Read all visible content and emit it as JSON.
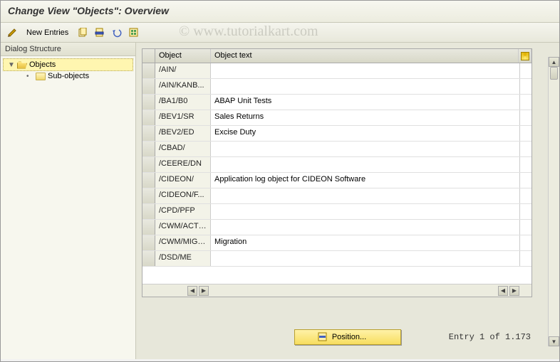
{
  "title": "Change View \"Objects\": Overview",
  "watermark": "© www.tutorialkart.com",
  "toolbar": {
    "new_entries": "New Entries"
  },
  "tree": {
    "header": "Dialog Structure",
    "root": {
      "label": "Objects"
    },
    "child": {
      "label": "Sub-objects"
    }
  },
  "table": {
    "columns": {
      "object": "Object",
      "object_text": "Object text"
    },
    "rows": [
      {
        "obj": "/AIN/",
        "txt": ""
      },
      {
        "obj": "/AIN/KANB...",
        "txt": ""
      },
      {
        "obj": "/BA1/B0",
        "txt": "ABAP Unit Tests"
      },
      {
        "obj": "/BEV1/SR",
        "txt": "Sales Returns"
      },
      {
        "obj": "/BEV2/ED",
        "txt": "Excise Duty"
      },
      {
        "obj": "/CBAD/",
        "txt": ""
      },
      {
        "obj": "/CEERE/DN",
        "txt": ""
      },
      {
        "obj": "/CIDEON/",
        "txt": "Application log object for CIDEON Software"
      },
      {
        "obj": "/CIDEON/F...",
        "txt": ""
      },
      {
        "obj": "/CPD/PFP",
        "txt": ""
      },
      {
        "obj": "/CWM/ACTI...",
        "txt": ""
      },
      {
        "obj": "/CWM/MIGR...",
        "txt": "Migration"
      },
      {
        "obj": "/DSD/ME",
        "txt": ""
      }
    ]
  },
  "footer": {
    "position_label": "Position...",
    "entry_text": "Entry 1 of 1.173"
  }
}
